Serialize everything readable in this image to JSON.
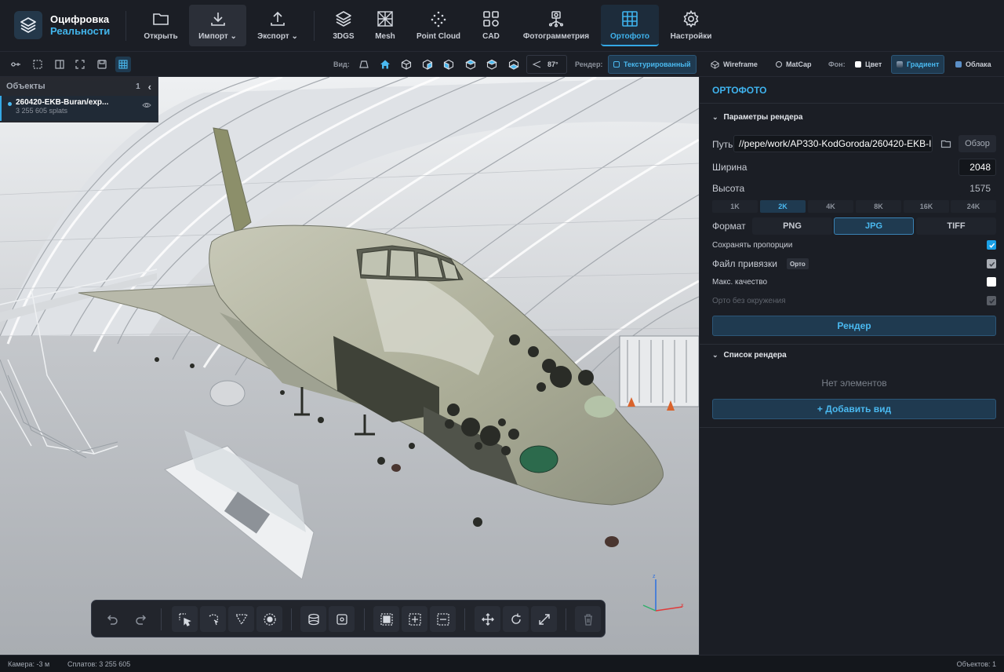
{
  "app": {
    "title_line1": "Оцифровка",
    "title_line2": "Реальности",
    "accent_color": "#34a8e5"
  },
  "toolbar": {
    "items": [
      {
        "label": "Открыть",
        "icon": "folder-icon"
      },
      {
        "label": "Импорт ⌄",
        "icon": "download-icon"
      },
      {
        "label": "Экспорт ⌄",
        "icon": "upload-icon"
      },
      {
        "label": "3DGS",
        "icon": "layers-icon"
      },
      {
        "label": "Mesh",
        "icon": "mesh-icon"
      },
      {
        "label": "Point Cloud",
        "icon": "point-cloud-icon"
      },
      {
        "label": "CAD",
        "icon": "cad-icon"
      },
      {
        "label": "Фотограмметрия",
        "icon": "photogrammetry-icon"
      },
      {
        "label": "Ортофото",
        "icon": "grid-icon",
        "active": true
      },
      {
        "label": "Настройки",
        "icon": "gear-icon"
      }
    ]
  },
  "view_toolbar": {
    "view_label": "Вид:",
    "fov": "87°",
    "render_label": "Рендер:",
    "render_modes": [
      "Текстурированный",
      "Wireframe",
      "MatCap"
    ],
    "render_active": "Текстурированный",
    "bg_label": "Фон:",
    "bg_modes": [
      "Цвет",
      "Градиент",
      "Облака"
    ],
    "bg_active": "Градиент"
  },
  "objects_panel": {
    "title": "Объекты",
    "count": "1",
    "items": [
      {
        "name": "260420-EKB-Buran/exp...",
        "meta": "3 255 605 splats"
      }
    ]
  },
  "ortho_panel": {
    "title": "ОРТОФОТО",
    "render_params_title": "Параметры рендера",
    "path_label": "Путь",
    "path_value": "//pepe/work/AP330-KodGoroda/260420-EKB-I",
    "browse_label": "Обзор",
    "width_label": "Ширина",
    "width_value": "2048",
    "height_label": "Высота",
    "height_value": "1575",
    "resolutions": [
      "1K",
      "2K",
      "4K",
      "8K",
      "16K",
      "24K"
    ],
    "resolution_active": "2K",
    "format_label": "Формат",
    "formats": [
      "PNG",
      "JPG",
      "TIFF"
    ],
    "format_active": "JPG",
    "keep_ratio_label": "Сохранять пропорции",
    "keep_ratio": true,
    "ref_file_label": "Файл привязки",
    "ref_file_badge": "Орто",
    "ref_file": true,
    "max_quality_label": "Макс. качество",
    "max_quality": false,
    "ortho_no_env_label": "Орто без окружения",
    "ortho_no_env": true,
    "render_button": "Рендер",
    "render_list_title": "Список рендера",
    "empty_text": "Нет элементов",
    "add_view_button": "+ Добавить вид"
  },
  "status_bar": {
    "camera": "Камера: -3 м",
    "splats": "Сплатов: 3 255 605",
    "objects": "Объектов: 1"
  }
}
